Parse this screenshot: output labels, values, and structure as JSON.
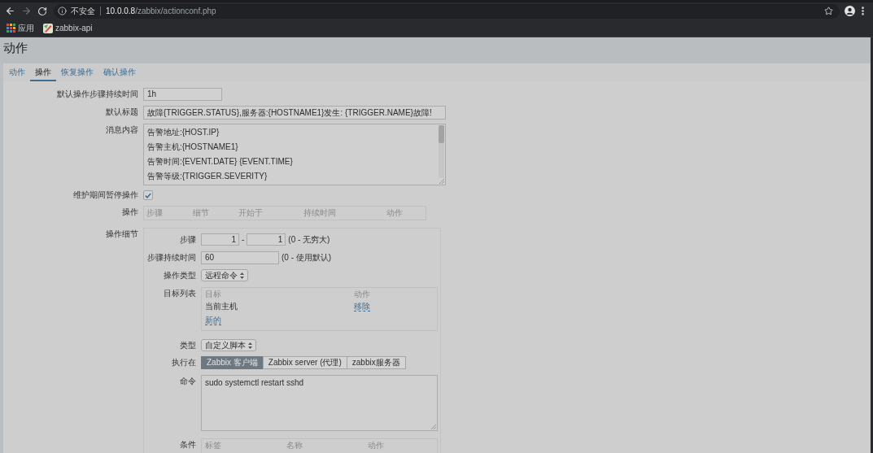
{
  "browser": {
    "security_label": "不安全",
    "url_host": "10.0.0.8",
    "url_path": "/zabbix/actionconf.php",
    "bookmarks": [
      {
        "kind": "apps",
        "label": "应用"
      },
      {
        "kind": "site",
        "label": "zabbix-api"
      }
    ]
  },
  "page": {
    "title": "动作"
  },
  "tabs": [
    {
      "label": "动作",
      "selected": false
    },
    {
      "label": "操作",
      "selected": true
    },
    {
      "label": "恢复操作",
      "selected": false
    },
    {
      "label": "确认操作",
      "selected": false
    }
  ],
  "form": {
    "default_step_duration": {
      "label": "默认操作步骤持续时间",
      "value": "1h"
    },
    "default_subject": {
      "label": "默认标题",
      "value": "故障{TRIGGER.STATUS},服务器:{HOSTNAME1}发生: {TRIGGER.NAME}故障!"
    },
    "default_message": {
      "label": "消息内容",
      "lines": [
        "告警地址:{HOST.IP}",
        "告警主机:{HOSTNAME1}",
        "告警时间:{EVENT.DATE} {EVENT.TIME}",
        "告警等级:{TRIGGER.SEVERITY}"
      ]
    },
    "pause_in_maintenance": {
      "label": "维护期间暂停操作",
      "checked": true
    },
    "operations": {
      "label": "操作",
      "columns": [
        "步骤",
        "细节",
        "开始于",
        "持续时间",
        "动作"
      ]
    },
    "operation_details": {
      "label": "操作细节",
      "steps": {
        "label": "步骤",
        "from": "1",
        "separator": "-",
        "to": "1",
        "hint": "(0 - 无穷大)"
      },
      "step_duration": {
        "label": "步骤持续时间",
        "value": "60",
        "hint": "(0 - 使用默认)"
      },
      "operation_type": {
        "label": "操作类型",
        "value": "远程命令"
      },
      "target_list": {
        "label": "目标列表",
        "columns": [
          "目标",
          "动作"
        ],
        "rows": [
          {
            "target": "当前主机",
            "action": "移除"
          }
        ],
        "new_link": "新的"
      },
      "type": {
        "label": "类型",
        "value": "自定义脚本"
      },
      "execute_on": {
        "label": "执行在",
        "options": [
          {
            "label": "Zabbix 客户端",
            "selected": true
          },
          {
            "label": "Zabbix server (代理)",
            "selected": false
          },
          {
            "label": "zabbix服务器",
            "selected": false
          }
        ]
      },
      "command": {
        "label": "命令",
        "value": "sudo systemctl restart sshd"
      },
      "conditions": {
        "label": "条件",
        "columns": [
          "标签",
          "名称",
          "动作"
        ]
      }
    }
  }
}
